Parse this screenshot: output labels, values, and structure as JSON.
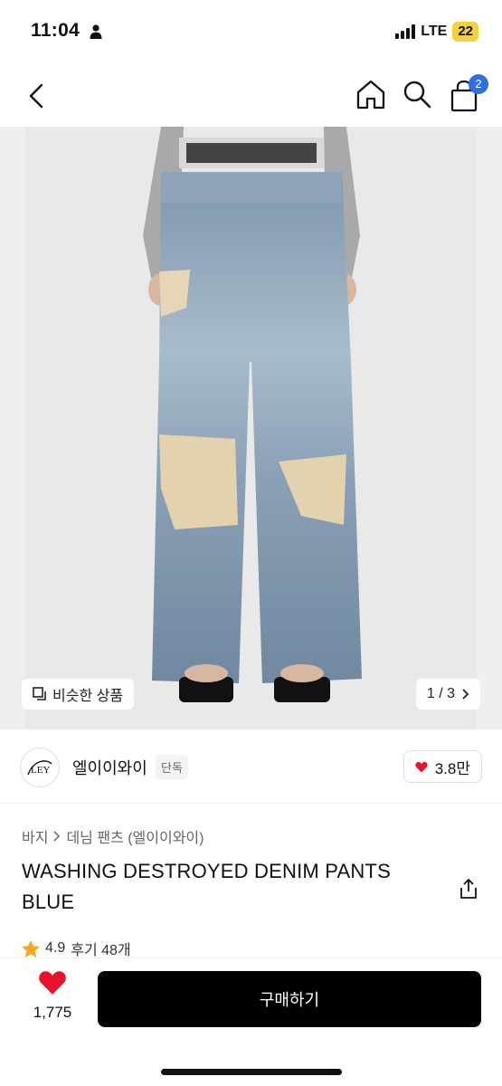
{
  "status_bar": {
    "time": "11:04",
    "network": "LTE",
    "battery": "22"
  },
  "nav": {
    "cart_count": "2"
  },
  "gallery": {
    "similar_label": "비슷한 상품",
    "pager": "1 / 3"
  },
  "seller": {
    "name": "엘이이와이",
    "tag": "단독",
    "likes": "3.8만"
  },
  "breadcrumb": {
    "category": "바지",
    "subcategory": "데님 팬츠 (엘이이와이)"
  },
  "product": {
    "title": "WASHING DESTROYED DENIM PANTS BLUE"
  },
  "rating": {
    "score": "4.9",
    "reviews": "후기 48개"
  },
  "bottom_bar": {
    "wish_count": "1,775",
    "buy_label": "구매하기"
  },
  "colors": {
    "accent_blue": "#2f6fe4",
    "heart_red": "#e8132b",
    "battery_yellow": "#f2d23a",
    "star": "#f5a623"
  }
}
